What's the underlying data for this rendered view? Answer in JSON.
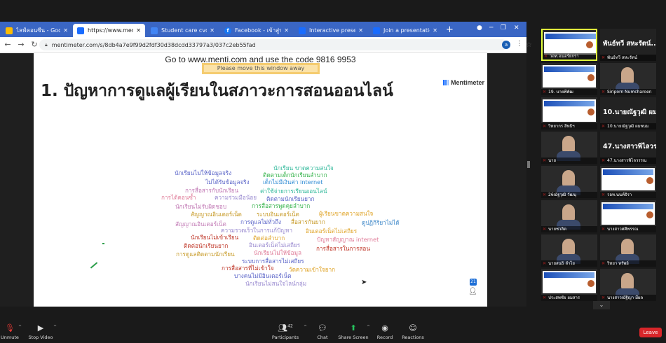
{
  "browser": {
    "tabs": [
      {
        "label": "ไลฟ์คอนซีน - Google ไดร",
        "fav_color": "#fbbc04"
      },
      {
        "label": "https://www.mentimeter",
        "fav_color": "#196cff"
      },
      {
        "label": "Student care cvc-cha",
        "fav_color": "#4285f4"
      },
      {
        "label": "Facebook - เข้าสู่ระบบหรือ",
        "fav_color": "#1877f2"
      },
      {
        "label": "Interactive presentation",
        "fav_color": "#196cff"
      },
      {
        "label": "Join a presentation",
        "fav_color": "#196cff"
      }
    ],
    "url": "mentimeter.com/s/8db4a7e9f99d2fdf30d38dcdd33797a3/037c2eb55fad"
  },
  "slide": {
    "join_message": "Go to www.menti.com and use the code 9816 9953",
    "banner": "Please move this window away",
    "logo_text": "Mentimeter",
    "title": "1. ปัญหาการดูแลผู้เรียนในสภาวะการสอนออนไลน์",
    "participant_count": "21",
    "words": [
      {
        "t": "นักเรียนไม่ให้ข้อมูลจริง",
        "c": "#5a64c8"
      },
      {
        "t": "นักเรียน ขาดความสนใจ",
        "c": "#2fb89a"
      },
      {
        "t": "ติดตามเด็กนักเรียนลำบาก",
        "c": "#35b34a"
      },
      {
        "t": "ไม่ได้รับข้อมูลจริง",
        "c": "#5a64c8"
      },
      {
        "t": "เด็กไม่มีเงินค่า internet",
        "c": "#2e8bd4"
      },
      {
        "t": "การสื่อสารกับนักเรียน",
        "c": "#c27ab5"
      },
      {
        "t": "ค่าใช้จ่ายการเรียนออนไลน์",
        "c": "#2fb89a"
      },
      {
        "t": "การได้คอนซ้ำ",
        "c": "#e07e9a"
      },
      {
        "t": "ความร่วมมือน้อย",
        "c": "#9a8bd0"
      },
      {
        "t": "ติดตามนักเรียนยาก",
        "c": "#5a64c8"
      },
      {
        "t": "นักเรียนไม่รับผิดชอบ",
        "c": "#c27ab5"
      },
      {
        "t": "การสื่อสารพูดคุยลำบาก",
        "c": "#35b34a"
      },
      {
        "t": "สัญญาณอินเตอร์เน็ต",
        "c": "#c79a27"
      },
      {
        "t": "ระบบอินเตอร์เน็ต",
        "c": "#c79a27"
      },
      {
        "t": "ผู้เรียนขาดความสนใจ",
        "c": "#e0a52a"
      },
      {
        "t": "สัญญาณอินเตอร์เน็ต",
        "c": "#c27ab5"
      },
      {
        "t": "การดูแลไม่ทั่วถึง",
        "c": "#5a64c8"
      },
      {
        "t": "สื่อสารกันยาก",
        "c": "#c79a27"
      },
      {
        "t": "ดูปฏิกิริยาไม่ได้",
        "c": "#3b86c8"
      },
      {
        "t": "ความรวดเร็วในการแก้ปัญหา",
        "c": "#9a8bd0"
      },
      {
        "t": "นักเรียนไม่เข้าเรียน",
        "c": "#c0392b"
      },
      {
        "t": "อินเตอร์เน็ตไม่เสถียร",
        "c": "#e0a52a"
      },
      {
        "t": "ติดต่อลำบาก",
        "c": "#e0a52a"
      },
      {
        "t": "ปัญหาสัญญาณ internet",
        "c": "#e07e9a"
      },
      {
        "t": "ติดต่อนักเรียนยาก",
        "c": "#c0392b"
      },
      {
        "t": "อินเตอร์เน็ตไม่เสถียร",
        "c": "#9a8bd0"
      },
      {
        "t": "การสื่อสารในการสอน",
        "c": "#c0392b"
      },
      {
        "t": "การดูแลติดตามนักเรียน",
        "c": "#c79a27"
      },
      {
        "t": "นักเรียนไม่ให้ข้อมูล",
        "c": "#e07e9a"
      },
      {
        "t": "ระบบการสื่อสารไม่เสถียร",
        "c": "#5a64c8"
      },
      {
        "t": "การสื่อสารที่ไม่เข้าใจ",
        "c": "#c0392b"
      },
      {
        "t": "วัดความเข้าใจยาก",
        "c": "#e0a52a"
      },
      {
        "t": "บางคนไม่มีอินเตอร์เน็ต",
        "c": "#5a64c8"
      },
      {
        "t": "นักเรียนไม่สนใจไลน์กลุ่ม",
        "c": "#9a8bd0"
      }
    ]
  },
  "gallery": {
    "tiles": [
      {
        "name": "วอท.ฉนอร์ยกรา",
        "kind": "slide",
        "active": true
      },
      {
        "name": "พันธ์ทวี สหะรัตน์",
        "kind": "bigname",
        "big": "พันธ์ทวี สหะรัตน์..."
      },
      {
        "name": "19. นายพีพัฒ",
        "kind": "slide"
      },
      {
        "name": "Siriporn Numcharoen",
        "kind": "person"
      },
      {
        "name": "วิทยากร สิทธิฯ",
        "kind": "slide"
      },
      {
        "name": "10.นายณัฐวุฒิ ผมพนม",
        "kind": "bigname",
        "big": "10.นายณัฐวุฒิ ผม..."
      },
      {
        "name": "นาย",
        "kind": "person"
      },
      {
        "name": "47.นางสาวพิไลวรรณ",
        "kind": "bigname",
        "big": "47.นางสาวพิไลวร..."
      },
      {
        "name": "26ณัฐวุฒิ วัฒนุ",
        "kind": "person"
      },
      {
        "name": "วอท.นนท์ธิรา",
        "kind": "slide"
      },
      {
        "name": "นายชวลิต",
        "kind": "person"
      },
      {
        "name": "นางสาวศศิพรรณ",
        "kind": "slide"
      },
      {
        "name": "นายสนธิ ลำไย",
        "kind": "person"
      },
      {
        "name": "วิทยา ทรัพย์",
        "kind": "person"
      },
      {
        "name": "ประสพชัย ยมสาร",
        "kind": "slide"
      },
      {
        "name": "นางสาวณัฐิญา มีผล",
        "kind": "person"
      }
    ]
  },
  "toolbar": {
    "unmute": "Unmute",
    "stop_video": "Stop Video",
    "participants": "Participants",
    "participants_count": "42",
    "chat": "Chat",
    "share_screen": "Share Screen",
    "record": "Record",
    "reactions": "Reactions",
    "leave": "Leave"
  },
  "colors": {
    "chrome_tabbar": "#3a66c4",
    "zoom_bg": "#1a1a1a",
    "share_green": "#26c45d",
    "leave_red": "#d9262a"
  }
}
